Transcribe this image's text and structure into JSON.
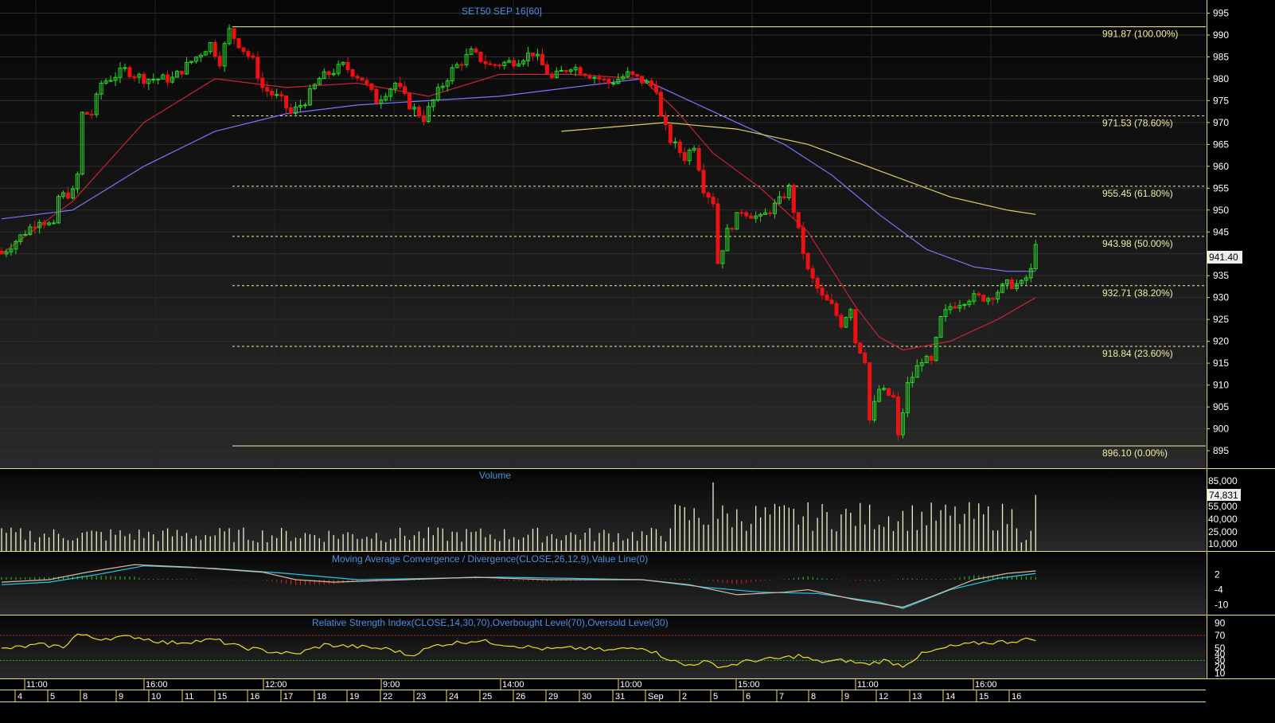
{
  "chart_data": {
    "type": "candlestick",
    "title": "SET50 SEP 16",
    "interval": "[60]",
    "price_axis": {
      "ylim": [
        891,
        998
      ],
      "ticks": [
        995,
        990,
        985,
        980,
        975,
        970,
        965,
        960,
        955,
        950,
        945,
        940,
        935,
        930,
        925,
        920,
        915,
        910,
        905,
        900,
        895
      ],
      "last_price": "941.40"
    },
    "fibonacci": {
      "color": "#f0f0a0",
      "levels": [
        {
          "price": 991.87,
          "label": "991.87 (100.00%)",
          "style": "solid"
        },
        {
          "price": 971.53,
          "label": "971.53 (78.60%)",
          "style": "dashed"
        },
        {
          "price": 955.45,
          "label": "955.45 (61.80%)",
          "style": "dashed"
        },
        {
          "price": 943.98,
          "label": "943.98 (50.00%)",
          "style": "dashed"
        },
        {
          "price": 932.71,
          "label": "932.71 (38.20%)",
          "style": "dashed"
        },
        {
          "price": 918.84,
          "label": "918.84 (23.60%)",
          "style": "dashed"
        },
        {
          "price": 896.1,
          "label": "896.10 (0.00%)",
          "style": "solid"
        }
      ]
    },
    "close_path": [
      [
        0,
        940
      ],
      [
        4,
        944
      ],
      [
        8,
        948
      ],
      [
        11,
        946
      ],
      [
        12,
        953
      ],
      [
        15,
        954
      ],
      [
        16,
        958
      ],
      [
        17,
        972
      ],
      [
        19,
        972
      ],
      [
        21,
        979
      ],
      [
        26,
        982
      ],
      [
        30,
        980
      ],
      [
        36,
        980
      ],
      [
        40,
        984
      ],
      [
        44,
        988
      ],
      [
        46,
        984
      ],
      [
        48,
        991
      ],
      [
        50,
        988
      ],
      [
        53,
        984
      ],
      [
        55,
        978
      ],
      [
        59,
        975
      ],
      [
        61,
        972
      ],
      [
        64,
        975
      ],
      [
        67,
        980
      ],
      [
        72,
        983
      ],
      [
        76,
        980
      ],
      [
        79,
        975
      ],
      [
        83,
        979
      ],
      [
        86,
        974
      ],
      [
        89,
        971
      ],
      [
        92,
        977
      ],
      [
        95,
        982
      ],
      [
        99,
        986
      ],
      [
        103,
        983
      ],
      [
        108,
        984
      ],
      [
        112,
        986
      ],
      [
        116,
        980
      ],
      [
        120,
        983
      ],
      [
        124,
        981
      ],
      [
        128,
        979
      ],
      [
        132,
        981
      ],
      [
        136,
        979
      ],
      [
        138,
        978
      ],
      [
        139,
        971
      ],
      [
        141,
        966
      ],
      [
        144,
        962
      ],
      [
        146,
        965
      ],
      [
        148,
        955
      ],
      [
        150,
        952
      ],
      [
        151,
        938
      ],
      [
        153,
        945
      ],
      [
        156,
        950
      ],
      [
        160,
        948
      ],
      [
        164,
        952
      ],
      [
        166,
        955
      ],
      [
        168,
        945
      ],
      [
        170,
        936
      ],
      [
        173,
        930
      ],
      [
        175,
        928
      ],
      [
        177,
        924
      ],
      [
        179,
        928
      ],
      [
        180,
        920
      ],
      [
        182,
        916
      ],
      [
        183,
        902
      ],
      [
        185,
        909
      ],
      [
        188,
        907
      ],
      [
        189,
        898
      ],
      [
        191,
        910
      ],
      [
        194,
        916
      ],
      [
        196,
        915
      ],
      [
        198,
        925
      ],
      [
        200,
        928
      ],
      [
        204,
        930
      ],
      [
        208,
        930
      ],
      [
        212,
        933
      ],
      [
        215,
        933
      ],
      [
        217,
        936
      ],
      [
        218,
        943
      ]
    ],
    "ema_red": [
      [
        0,
        940
      ],
      [
        15,
        952
      ],
      [
        30,
        970
      ],
      [
        45,
        980
      ],
      [
        60,
        978
      ],
      [
        75,
        979
      ],
      [
        90,
        976
      ],
      [
        105,
        981
      ],
      [
        120,
        981
      ],
      [
        135,
        980
      ],
      [
        142,
        973
      ],
      [
        150,
        963
      ],
      [
        160,
        955
      ],
      [
        170,
        945
      ],
      [
        180,
        928
      ],
      [
        185,
        921
      ],
      [
        190,
        918
      ],
      [
        200,
        920
      ],
      [
        210,
        925
      ],
      [
        218,
        930
      ]
    ],
    "ema_blue": [
      [
        0,
        948
      ],
      [
        15,
        950
      ],
      [
        30,
        960
      ],
      [
        45,
        968
      ],
      [
        60,
        972
      ],
      [
        75,
        974
      ],
      [
        90,
        975
      ],
      [
        105,
        976
      ],
      [
        120,
        978
      ],
      [
        135,
        980
      ],
      [
        145,
        975
      ],
      [
        155,
        970
      ],
      [
        165,
        965
      ],
      [
        175,
        958
      ],
      [
        185,
        949
      ],
      [
        195,
        941
      ],
      [
        205,
        937
      ],
      [
        212,
        936
      ],
      [
        218,
        936
      ]
    ],
    "ema_yellow": [
      [
        118,
        968
      ],
      [
        140,
        970
      ],
      [
        155,
        968.5
      ],
      [
        170,
        965
      ],
      [
        185,
        959
      ],
      [
        200,
        953
      ],
      [
        212,
        950
      ],
      [
        218,
        949
      ]
    ],
    "x_time_labels": [
      "11:00",
      "16:00",
      "12:00",
      "9:00",
      "14:00",
      "10:00",
      "15:00",
      "11:00",
      "16:00"
    ],
    "x_date_labels": [
      "4",
      "5",
      "8",
      "9",
      "10",
      "11",
      "15",
      "16",
      "17",
      "18",
      "19",
      "22",
      "23",
      "24",
      "25",
      "26",
      "29",
      "30",
      "31",
      "Sep",
      "2",
      "5",
      "6",
      "7",
      "8",
      "9",
      "12",
      "13",
      "14",
      "15",
      "16"
    ],
    "volume": {
      "title": "Volume",
      "ticks": [
        "85,000",
        "55,000",
        "40,000",
        "25,000",
        "10,000"
      ],
      "last_value": "74,831",
      "spike_value": 92000
    },
    "macd": {
      "title": "Moving Average Convergence / Divergence(CLOSE,26,12,9),Value Line(0)",
      "ticks": [
        "2",
        "-4",
        "-10"
      ],
      "ylim": [
        -14,
        7
      ],
      "macd_line": [
        [
          0,
          -1
        ],
        [
          10,
          0
        ],
        [
          18,
          3
        ],
        [
          28,
          6
        ],
        [
          40,
          5
        ],
        [
          55,
          3
        ],
        [
          62,
          0
        ],
        [
          70,
          -1
        ],
        [
          85,
          0
        ],
        [
          100,
          1
        ],
        [
          115,
          0
        ],
        [
          135,
          0
        ],
        [
          145,
          -2
        ],
        [
          155,
          -6
        ],
        [
          165,
          -5
        ],
        [
          170,
          -4
        ],
        [
          180,
          -8
        ],
        [
          190,
          -11
        ],
        [
          197,
          -6
        ],
        [
          205,
          0
        ],
        [
          212,
          2.5
        ],
        [
          218,
          3.5
        ]
      ],
      "signal_line": [
        [
          0,
          -2
        ],
        [
          10,
          -1
        ],
        [
          20,
          2
        ],
        [
          30,
          5.5
        ],
        [
          45,
          4.5
        ],
        [
          60,
          2.5
        ],
        [
          75,
          0
        ],
        [
          90,
          0.5
        ],
        [
          105,
          1
        ],
        [
          120,
          0.5
        ],
        [
          135,
          0
        ],
        [
          148,
          -3
        ],
        [
          160,
          -5
        ],
        [
          172,
          -5.5
        ],
        [
          185,
          -9
        ],
        [
          190,
          -11.5
        ],
        [
          200,
          -4
        ],
        [
          210,
          0.5
        ],
        [
          218,
          2.5
        ]
      ]
    },
    "rsi": {
      "title": "Relative Strength Index(CLOSE,14,30,70),Overbought Level(70),Oversold Level(30)",
      "ticks": [
        "90",
        "70",
        "50",
        "40",
        "30",
        "20",
        "10"
      ],
      "overbought": 70,
      "oversold": 30,
      "ylim": [
        4,
        98
      ],
      "values": [
        [
          0,
          48
        ],
        [
          8,
          55
        ],
        [
          13,
          52
        ],
        [
          16,
          72
        ],
        [
          20,
          65
        ],
        [
          28,
          68
        ],
        [
          35,
          58
        ],
        [
          45,
          63
        ],
        [
          50,
          52
        ],
        [
          56,
          45
        ],
        [
          62,
          40
        ],
        [
          68,
          55
        ],
        [
          75,
          52
        ],
        [
          82,
          48
        ],
        [
          86,
          38
        ],
        [
          92,
          55
        ],
        [
          100,
          62
        ],
        [
          107,
          55
        ],
        [
          115,
          48
        ],
        [
          122,
          50
        ],
        [
          128,
          46
        ],
        [
          135,
          52
        ],
        [
          140,
          35
        ],
        [
          144,
          22
        ],
        [
          148,
          28
        ],
        [
          152,
          20
        ],
        [
          158,
          30
        ],
        [
          164,
          33
        ],
        [
          168,
          38
        ],
        [
          172,
          28
        ],
        [
          178,
          30
        ],
        [
          182,
          24
        ],
        [
          186,
          30
        ],
        [
          190,
          22
        ],
        [
          194,
          40
        ],
        [
          200,
          52
        ],
        [
          206,
          58
        ],
        [
          212,
          60
        ],
        [
          218,
          65
        ]
      ]
    }
  }
}
